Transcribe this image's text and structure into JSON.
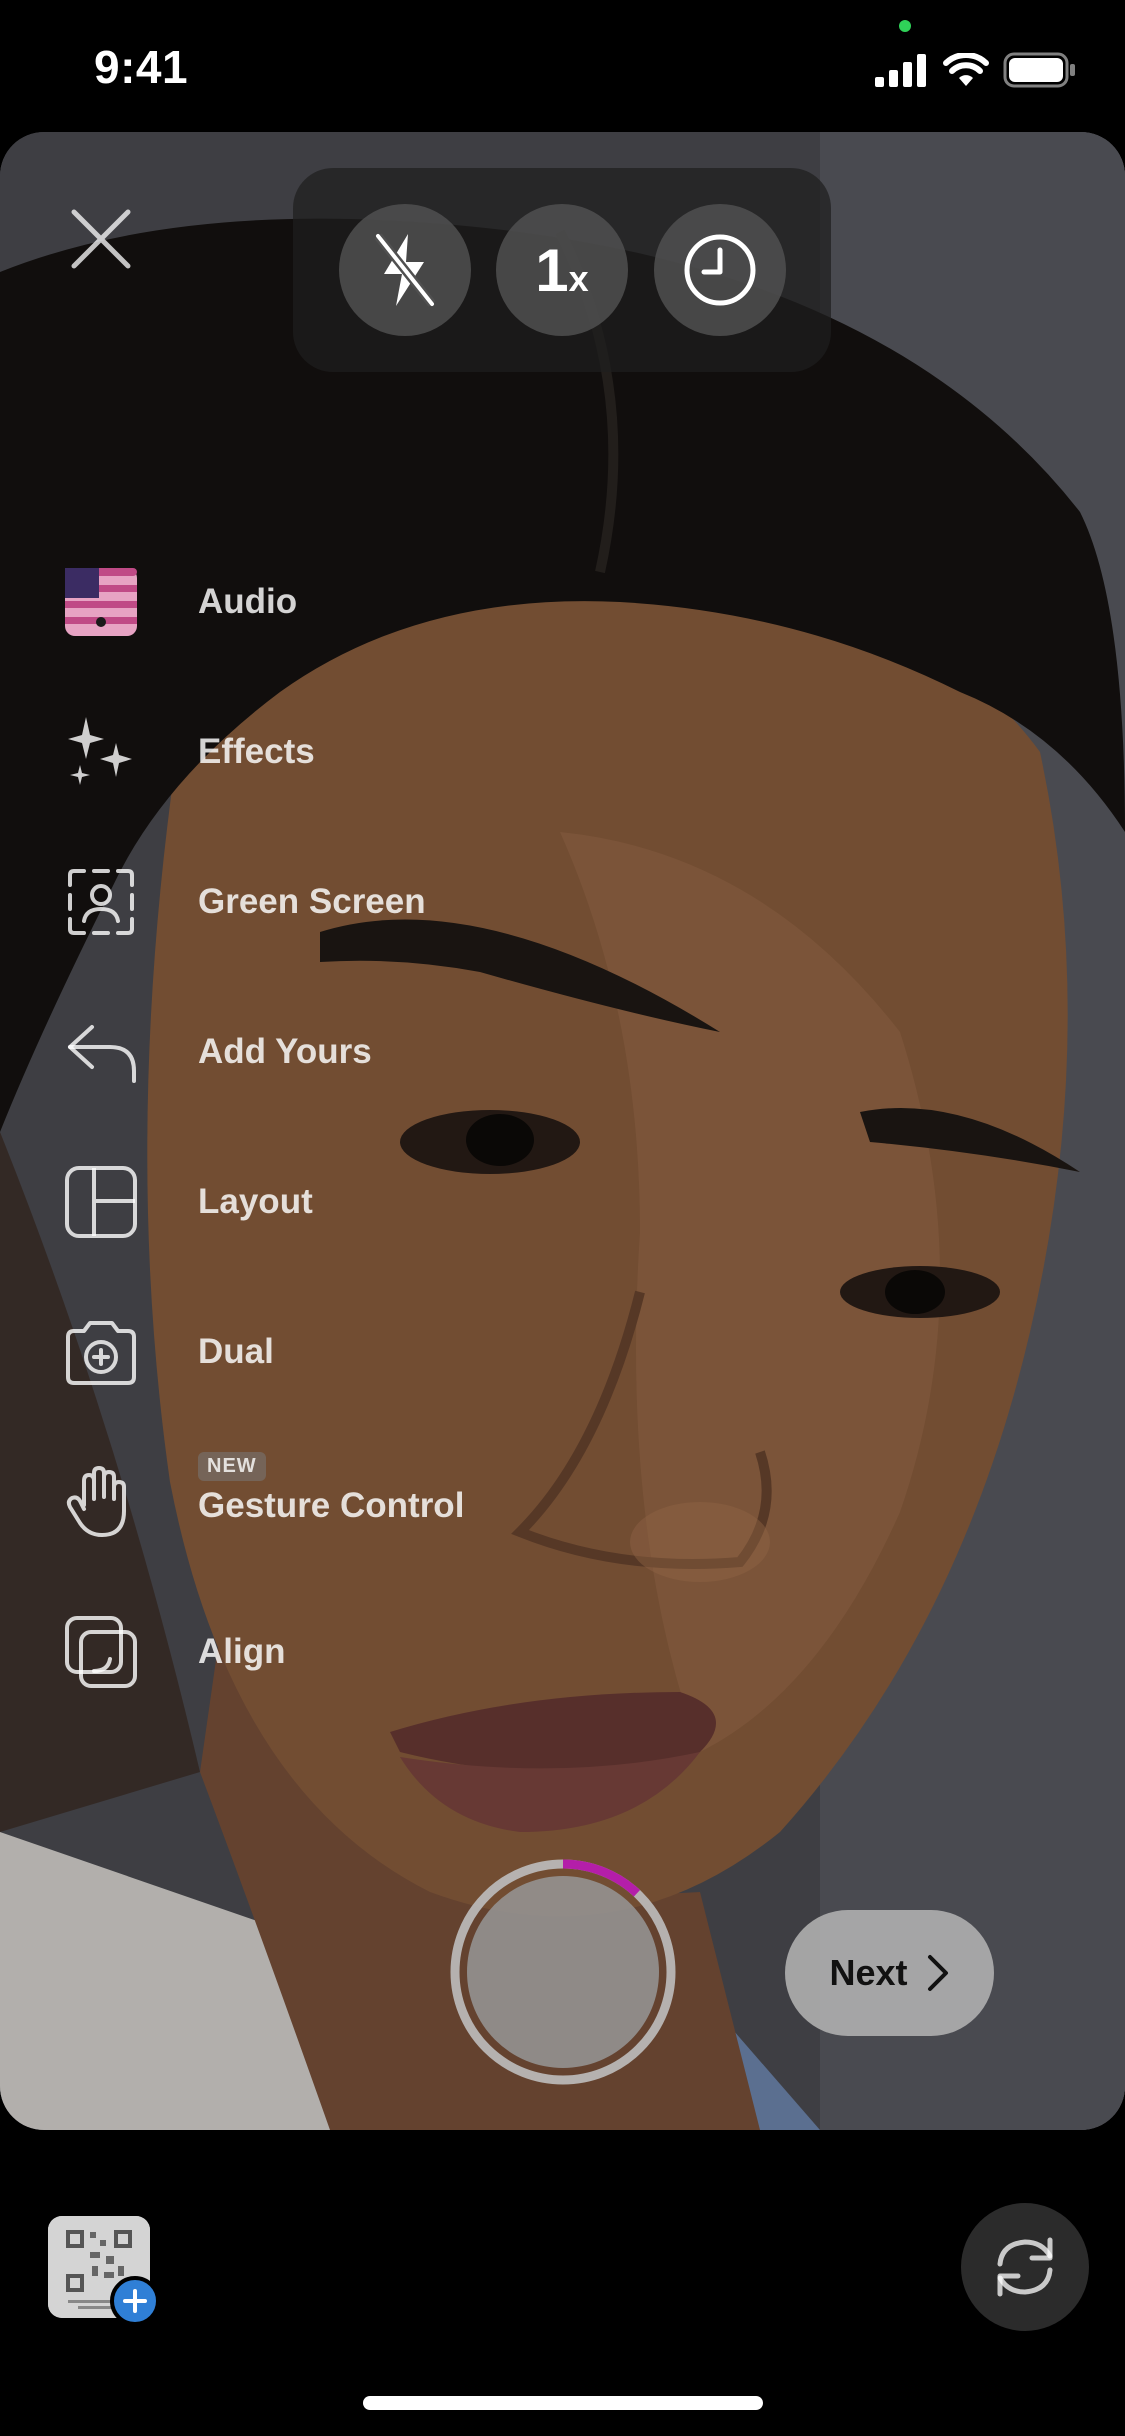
{
  "status_bar": {
    "time": "9:41"
  },
  "top_controls": {
    "zoom_label": "1",
    "zoom_suffix": "x"
  },
  "tool_menu": {
    "items": [
      {
        "label": "Audio",
        "icon": "us-flag-audio-thumbnail"
      },
      {
        "label": "Effects",
        "icon": "sparkles-icon"
      },
      {
        "label": "Green Screen",
        "icon": "green-screen-icon"
      },
      {
        "label": "Add Yours",
        "icon": "reply-arrow-icon"
      },
      {
        "label": "Layout",
        "icon": "layout-icon"
      },
      {
        "label": "Dual",
        "icon": "dual-camera-icon"
      },
      {
        "label": "Gesture Control",
        "icon": "hand-icon",
        "badge": "NEW"
      },
      {
        "label": "Align",
        "icon": "align-icon"
      }
    ]
  },
  "shutter": {
    "progress_fraction": 0.12,
    "progress_color": "#b41ea9"
  },
  "next_button": {
    "label": "Next"
  },
  "colors": {
    "accent_progress": "#b41ea9",
    "gallery_badge": "#2f7fd6",
    "privacy_dot": "#2fd158"
  }
}
